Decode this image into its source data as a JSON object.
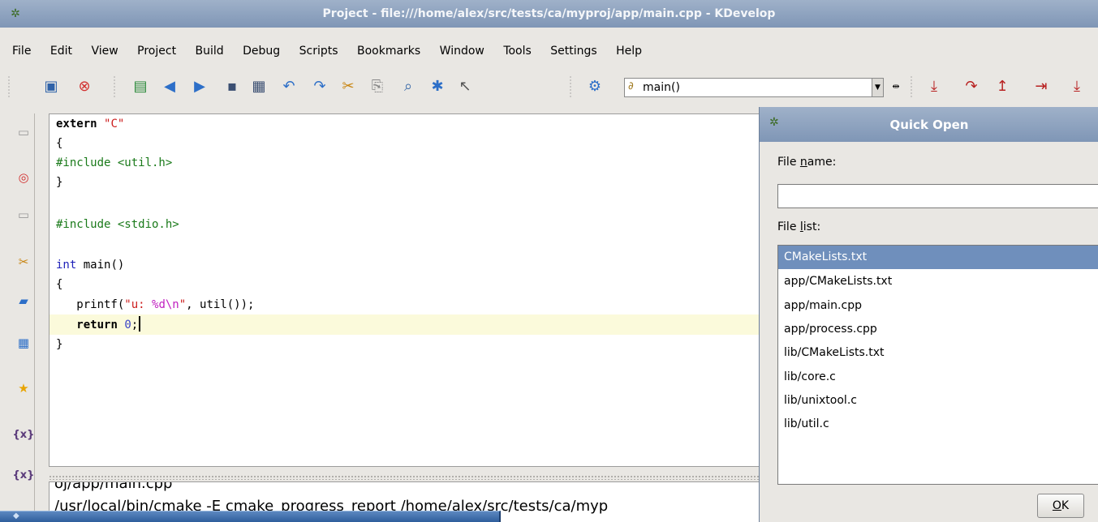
{
  "window": {
    "title": "Project - file:///home/alex/src/tests/ca/myproj/app/main.cpp - KDevelop"
  },
  "menu": [
    "File",
    "Edit",
    "View",
    "Project",
    "Build",
    "Debug",
    "Scripts",
    "Bookmarks",
    "Window",
    "Tools",
    "Settings",
    "Help"
  ],
  "toolbar": {
    "context_combo": "main()",
    "icons": [
      "new-file-icon",
      "close-icon",
      "open-project-icon",
      "back-icon",
      "forward-icon",
      "save-icon",
      "save-all-icon",
      "undo-icon",
      "redo-icon",
      "cut-icon",
      "copy-icon",
      "find-icon",
      "settings-icon",
      "whats-this-icon",
      "project-icon",
      "step-into-icon",
      "step-over-icon",
      "step-out-icon",
      "run-to-cursor-icon",
      "toggle-breakpoint-icon"
    ]
  },
  "leftdock": [
    "document-icon",
    "lifebuoy-icon",
    "document-icon",
    "cut-icon",
    "folder-icon",
    "class-icon",
    "star-icon",
    "variables-icon",
    "variables-icon"
  ],
  "editor": {
    "lines": [
      "extern \"C\"",
      "{",
      "#include <util.h>",
      "}",
      "",
      "#include <stdio.h>",
      "",
      "int main()",
      "{",
      "   printf(\"u: %d\\n\", util());",
      "   return 0;",
      "}"
    ]
  },
  "output": {
    "lines": [
      "oj/app/main.cpp",
      "/usr/local/bin/cmake -E cmake_progress_report /home/alex/src/tests/ca/myp"
    ]
  },
  "quick_open": {
    "title": "Quick Open",
    "file_name_label": "File name:",
    "file_name_value": "",
    "file_list_label": "File list:",
    "files": [
      "CMakeLists.txt",
      "app/CMakeLists.txt",
      "app/main.cpp",
      "app/process.cpp",
      "lib/CMakeLists.txt",
      "lib/core.c",
      "lib/unixtool.c",
      "lib/util.c"
    ],
    "selected_index": 0,
    "ok_label": "OK"
  }
}
